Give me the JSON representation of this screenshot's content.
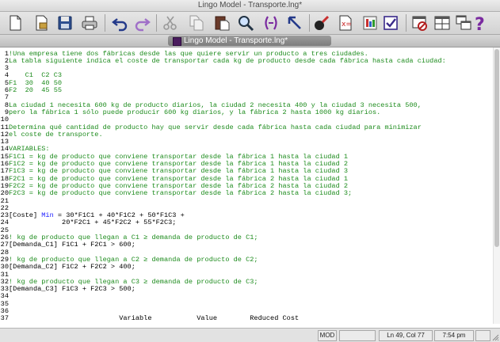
{
  "window": {
    "title": "Lingo Model - Transporte.lng*"
  },
  "document": {
    "tab_title": "Lingo Model - Transporte.lng*"
  },
  "toolbar": [
    {
      "name": "new-icon"
    },
    {
      "name": "open-icon"
    },
    {
      "name": "save-icon"
    },
    {
      "name": "print-icon"
    },
    {
      "name": "undo-icon"
    },
    {
      "name": "redo-icon"
    },
    {
      "name": "cut-icon"
    },
    {
      "name": "copy-icon"
    },
    {
      "name": "paste-icon"
    },
    {
      "name": "find-icon"
    },
    {
      "name": "match-parenthesis-icon"
    },
    {
      "name": "go-to-line-icon"
    },
    {
      "name": "solve-icon"
    },
    {
      "name": "solution-icon"
    },
    {
      "name": "options-icon"
    },
    {
      "name": "send-to-back-icon"
    },
    {
      "name": "close-all-icon"
    },
    {
      "name": "tile-icon"
    },
    {
      "name": "help-icon"
    }
  ],
  "editor_lines": [
    {
      "n": "1",
      "t": "!Una empresa tiene dos fábricas desde las que quiere servir un producto a tres ciudades.",
      "c": "comment"
    },
    {
      "n": "2",
      "t": "La tabla siguiente indica el coste de transportar cada kg de producto desde cada fábrica hasta cada ciudad:",
      "c": "comment"
    },
    {
      "n": "3",
      "t": "",
      "c": "comment"
    },
    {
      "n": "4",
      "t": "    C1  C2 C3",
      "c": "comment"
    },
    {
      "n": "5",
      "t": "F1  30  40 50",
      "c": "comment"
    },
    {
      "n": "6",
      "t": "F2  20  45 55",
      "c": "comment"
    },
    {
      "n": "7",
      "t": "",
      "c": "comment"
    },
    {
      "n": "8",
      "t": "La ciudad 1 necesita 600 kg de producto diarios, la ciudad 2 necesita 400 y la ciudad 3 necesita 500,",
      "c": "comment"
    },
    {
      "n": "9",
      "t": "pero la fábrica 1 sólo puede producir 600 kg diarios, y la fábrica 2 hasta 1000 kg diarios.",
      "c": "comment"
    },
    {
      "n": "10",
      "t": "",
      "c": "comment"
    },
    {
      "n": "11",
      "t": "Determina qué cantidad de producto hay que servir desde cada fábrica hasta cada ciudad para minimizar",
      "c": "comment"
    },
    {
      "n": "12",
      "t": "el coste de transporte.",
      "c": "comment"
    },
    {
      "n": "13",
      "t": "",
      "c": "comment"
    },
    {
      "n": "14",
      "t": "VARIABLES:",
      "c": "comment"
    },
    {
      "n": "15",
      "t": "F1C1 = kg de producto que conviene transportar desde la fábrica 1 hasta la ciudad 1",
      "c": "comment"
    },
    {
      "n": "16",
      "t": "F1C2 = kg de producto que conviene transportar desde la fábrica 1 hasta la ciudad 2",
      "c": "comment"
    },
    {
      "n": "17",
      "t": "F1C3 = kg de producto que conviene transportar desde la fábrica 1 hasta la ciudad 3",
      "c": "comment"
    },
    {
      "n": "18",
      "t": "F2C1 = kg de producto que conviene transportar desde la fábrica 2 hasta la ciudad 1",
      "c": "comment"
    },
    {
      "n": "19",
      "t": "F2C2 = kg de producto que conviene transportar desde la fábrica 2 hasta la ciudad 2",
      "c": "comment"
    },
    {
      "n": "20",
      "t": "F2C3 = kg de producto que conviene transportar desde la fábrica 2 hasta la ciudad 3;",
      "c": "comment"
    },
    {
      "n": "21",
      "t": "",
      "c": "code"
    },
    {
      "n": "22",
      "t": "",
      "c": "code"
    },
    {
      "n": "23",
      "t": "",
      "c": "objective"
    },
    {
      "n": "24",
      "t": "             20*F2C1 + 45*F2C2 + 55*F2C3;",
      "c": "code"
    },
    {
      "n": "25",
      "t": "",
      "c": "code"
    },
    {
      "n": "26",
      "t": "! kg de producto que llegan a C1 ≥ demanda de producto de C1;",
      "c": "comment"
    },
    {
      "n": "27",
      "t": "[Demanda_C1] F1C1 + F2C1 > 600;",
      "c": "code"
    },
    {
      "n": "28",
      "t": "",
      "c": "code"
    },
    {
      "n": "29",
      "t": "! kg de producto que llegan a C2 ≥ demanda de producto de C2;",
      "c": "comment"
    },
    {
      "n": "30",
      "t": "[Demanda_C2] F1C2 + F2C2 > 400;",
      "c": "code"
    },
    {
      "n": "31",
      "t": "",
      "c": "code"
    },
    {
      "n": "32",
      "t": "! kg de producto que llegan a C3 ≥ demanda de producto de C3;",
      "c": "comment"
    },
    {
      "n": "33",
      "t": "[Demanda_C3] F1C3 + F2C3 > 500;",
      "c": "code"
    },
    {
      "n": "34",
      "t": "",
      "c": "code"
    },
    {
      "n": "35",
      "t": "",
      "c": "code"
    },
    {
      "n": "36",
      "t": "",
      "c": "code"
    },
    {
      "n": "37",
      "t": "                           Variable           Value        Reduced Cost",
      "c": "code"
    }
  ],
  "objective": {
    "prefix": "[Coste] ",
    "keyword": "Min",
    "rest": " = 30*F1C1 + 40*F1C2 + 50*F1C3 +"
  },
  "status": {
    "mode": "MOD",
    "position": "Ln 49, Col 77",
    "time": "7:54 pm"
  },
  "colors": {
    "comment": "#1e8c1e",
    "keyword": "#1a1aff",
    "code": "#000000"
  }
}
